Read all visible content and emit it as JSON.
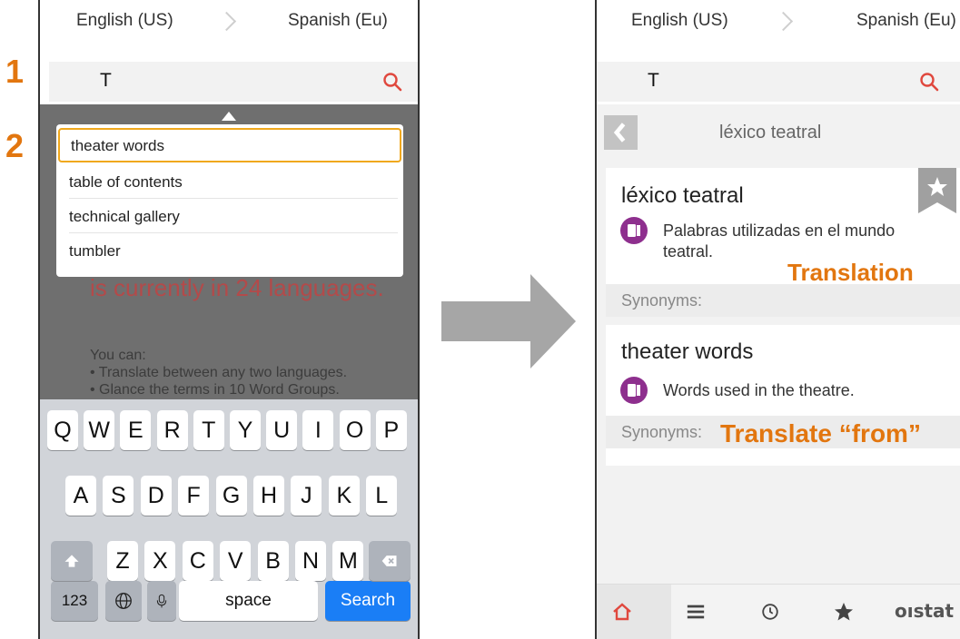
{
  "annotations": {
    "step1": "1",
    "step2": "2",
    "translation_label": "Translation",
    "from_label": "Translate “from”"
  },
  "left": {
    "lang_from": "English (US)",
    "lang_to": "Spanish (Eu)",
    "search_value": "T",
    "suggestions": [
      "theater words",
      "table of contents",
      "technical gallery",
      "tumbler"
    ],
    "promo_line": "is currently in 24 languages.",
    "tips_heading": "You can:",
    "tips": [
      "• Translate between any two languages.",
      "• Glance the terms in 10 Word Groups."
    ],
    "keyboard": {
      "row1": [
        "Q",
        "W",
        "E",
        "R",
        "T",
        "Y",
        "U",
        "I",
        "O",
        "P"
      ],
      "row2": [
        "A",
        "S",
        "D",
        "F",
        "G",
        "H",
        "J",
        "K",
        "L"
      ],
      "row3": [
        "Z",
        "X",
        "C",
        "V",
        "B",
        "N",
        "M"
      ],
      "numbers": "123",
      "space": "space",
      "search": "Search"
    }
  },
  "right": {
    "lang_from": "English (US)",
    "lang_to": "Spanish (Eu)",
    "search_value": "T",
    "header_title": "léxico teatral",
    "entries": [
      {
        "term": "léxico teatral",
        "definition": "Palabras utilizadas en el mundo teatral.",
        "synonyms_label": "Synonyms:"
      },
      {
        "term": "theater words",
        "definition": "Words used in the theatre.",
        "synonyms_label": "Synonyms:"
      }
    ],
    "tab_logo": "oıstat",
    "tabs": [
      "home-icon",
      "menu-icon",
      "history-icon",
      "favorites-icon",
      "oistat-logo"
    ]
  },
  "colors": {
    "accent_orange": "#e2760f",
    "highlight_yellow": "#f0a81d",
    "search_red": "#e0483e",
    "book_purple": "#8e2f8e",
    "ios_blue": "#1a7ef6"
  }
}
